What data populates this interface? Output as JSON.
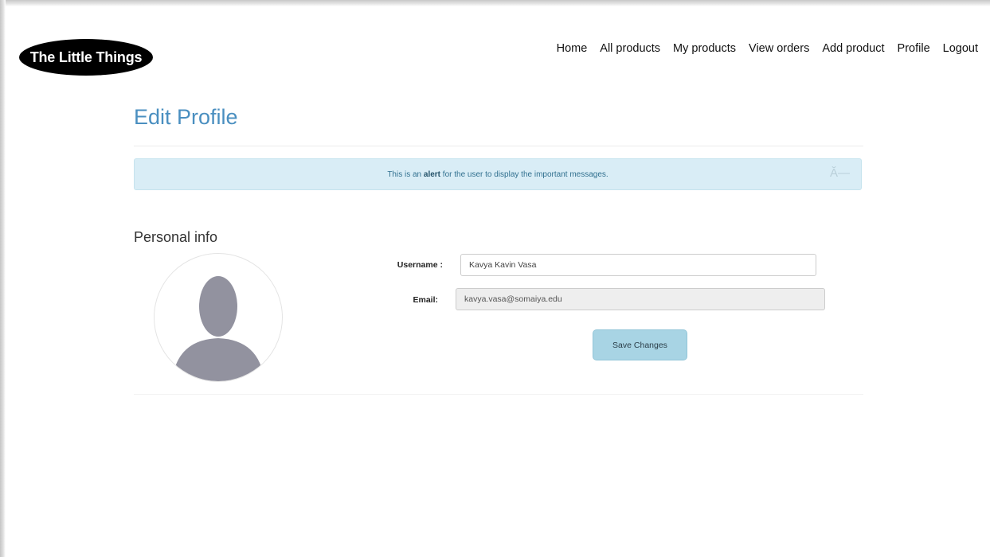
{
  "brand": {
    "logo_text": "The Little Things"
  },
  "nav": {
    "items": [
      "Home",
      "All products",
      "My products",
      "View orders",
      "Add product",
      "Profile",
      "Logout"
    ]
  },
  "page": {
    "title": "Edit Profile"
  },
  "alert": {
    "prefix": "This is an ",
    "emphasis": "alert",
    "suffix": " for the user to display the important messages.",
    "close_label": "Ă—"
  },
  "personal": {
    "section_title": "Personal info",
    "username_label": "Username :",
    "username_value": "Kavya Kavin Vasa",
    "email_label": "Email:",
    "email_value": "kavya.vasa@somaiya.edu",
    "save_label": "Save Changes"
  },
  "colors": {
    "title_blue": "#4a8fc0",
    "alert_bg": "#d9edf6",
    "button_bg": "#a8d4e4",
    "avatar_gray": "#92929f"
  }
}
